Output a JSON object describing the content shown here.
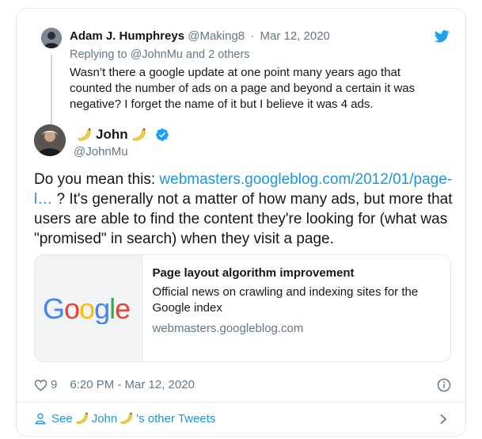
{
  "parent_tweet": {
    "name": "Adam J. Humphreys",
    "handle": "@Making8",
    "separator": "·",
    "date": "Mar 12, 2020",
    "replying_prefix": "Replying to",
    "replying_to": "@JohnMu",
    "replying_suffix": "and 2 others",
    "text": "Wasn’t there a google update at one point many years ago that counted the number of ads on a page and beyond a certain it was negative? I forget the name of it but I believe it was 4 ads."
  },
  "main_tweet": {
    "name": "John",
    "handle": "@JohnMu",
    "text_before_link": "Do you mean this: ",
    "link_text": "webmasters.googleblog.com/2012/01/page-l…",
    "text_after_link": " ? It's generally not a matter of how many ads, but more that users are able to find the content they're looking for (what was \"promised\" in search) when they visit a page.",
    "link_card": {
      "title": "Page layout algorithm improvement",
      "description": "Official news on crawling and indexing sites for the Google index",
      "domain": "webmasters.googleblog.com",
      "thumb_logo": "Google"
    },
    "likes": "9",
    "timestamp": "6:20 PM - Mar 12, 2020"
  },
  "footer": {
    "prefix": "See",
    "name": "John",
    "suffix": "'s other Tweets"
  },
  "icons": {
    "brand": "twitter-bird-icon",
    "verified": "verified-badge-icon",
    "like": "heart-icon",
    "info": "info-icon",
    "person": "person-icon",
    "chevron": "chevron-right-icon",
    "emoji": "banana-icon"
  },
  "colors": {
    "twitter_blue": "#1da1f2",
    "link_blue": "#1b95e0",
    "muted_text": "#657786",
    "border": "#e1e8ed"
  }
}
